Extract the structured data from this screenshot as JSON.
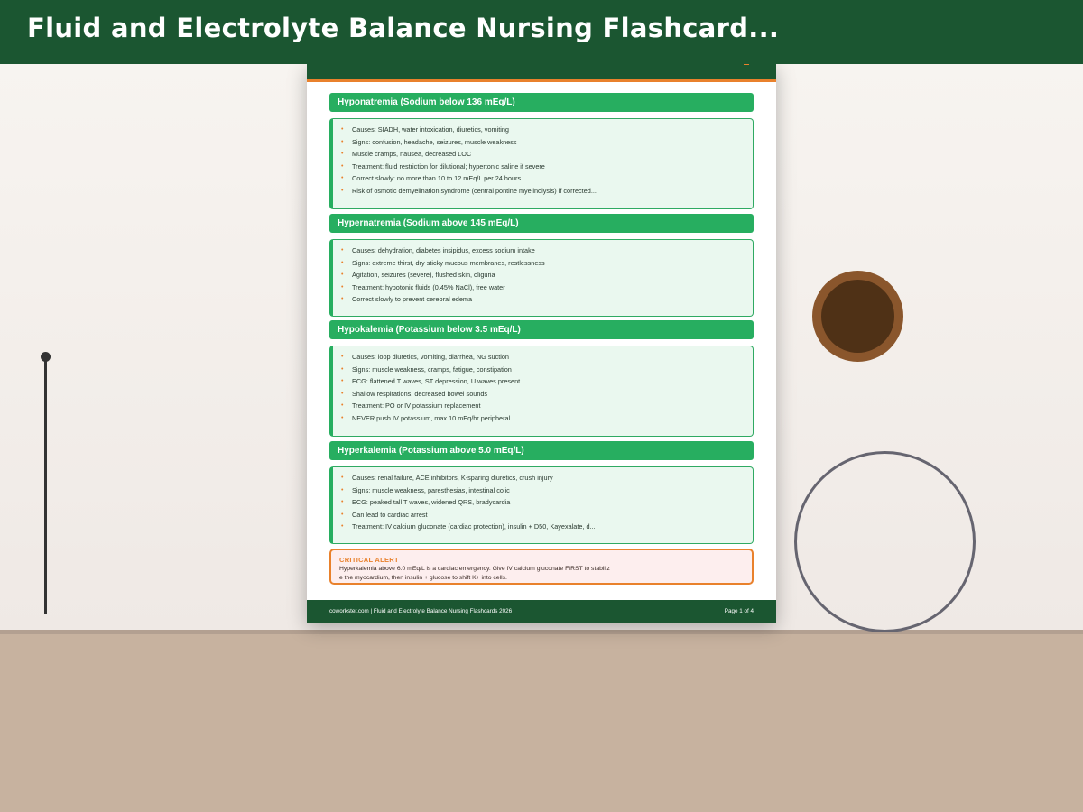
{
  "header": {
    "title": "Fluid and Electrolyte Balance Nursing Flashcard..."
  },
  "sections": [
    {
      "title": "Hyponatremia (Sodium below 136 mEq/L)",
      "items": [
        "Causes: SIADH, water intoxication, diuretics, vomiting",
        "Signs: confusion, headache, seizures, muscle weakness",
        "Muscle cramps, nausea, decreased LOC",
        "Treatment: fluid restriction for dilutional; hypertonic saline if severe",
        "Correct slowly: no more than 10 to 12 mEq/L per 24 hours",
        "Risk of osmotic demyelination syndrome (central pontine myelinolysis) if corrected..."
      ]
    },
    {
      "title": "Hypernatremia (Sodium above 145 mEq/L)",
      "items": [
        "Causes: dehydration, diabetes insipidus, excess sodium intake",
        "Signs: extreme thirst, dry sticky mucous membranes, restlessness",
        "Agitation, seizures (severe), flushed skin, oliguria",
        "Treatment: hypotonic fluids (0.45% NaCl), free water",
        "Correct slowly to prevent cerebral edema"
      ]
    },
    {
      "title": "Hypokalemia (Potassium below 3.5 mEq/L)",
      "items": [
        "Causes: loop diuretics, vomiting, diarrhea, NG suction",
        "Signs: muscle weakness, cramps, fatigue, constipation",
        "ECG: flattened T waves, ST depression, U waves present",
        "Shallow respirations, decreased bowel sounds",
        "Treatment: PO or IV potassium replacement",
        "NEVER push IV potassium, max 10 mEq/hr peripheral"
      ]
    },
    {
      "title": "Hyperkalemia (Potassium above 5.0 mEq/L)",
      "items": [
        "Causes: renal failure, ACE inhibitors, K-sparing diuretics, crush injury",
        "Signs: muscle weakness, paresthesias, intestinal colic",
        "ECG: peaked tall T waves, widened QRS, bradycardia",
        "Can lead to cardiac arrest",
        "Treatment: IV calcium gluconate (cardiac protection), insulin + D50, Kayexalate, d..."
      ]
    }
  ],
  "alert": {
    "title": "CRITICAL ALERT",
    "body": "Hyperkalemia above 6.0 mEq/L is a cardiac emergency. Give IV calcium gluconate FIRST to stabilize the myocardium, then insulin + glucose to shift K+ into cells."
  },
  "footer": {
    "left": "coworkster.com | Fluid and Electrolyte Balance Nursing Flashcards 2026",
    "right": "Page 1 of 4"
  },
  "colors": {
    "header_green": "#1b5631",
    "section_green": "#27ae60",
    "accent_orange": "#e9812c",
    "box_bg": "#eaf8ef",
    "alert_bg": "#fdeeee"
  }
}
